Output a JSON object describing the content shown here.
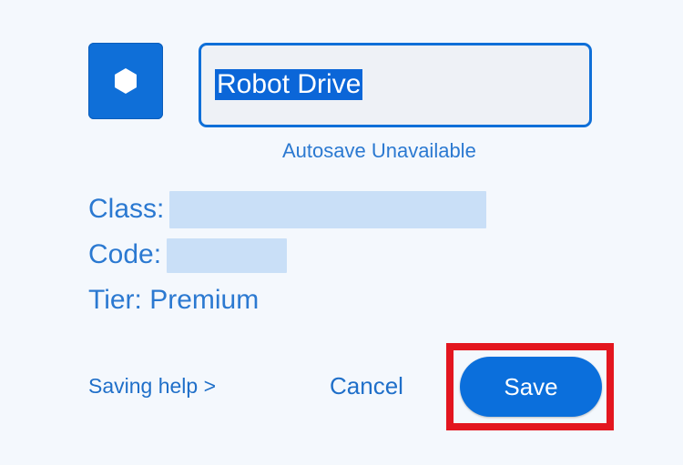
{
  "app_icon": {
    "icon": "hexagon-icon",
    "color": "#0f6fd8"
  },
  "name_field": {
    "value": "Robot Drive",
    "selected": true
  },
  "autosave_note": "Autosave Unavailable",
  "details": {
    "class_label": "Class:",
    "code_label": "Code:",
    "tier_label": "Tier: Premium"
  },
  "footer": {
    "help_link": "Saving help >",
    "cancel_label": "Cancel",
    "save_label": "Save"
  },
  "colors": {
    "accent": "#0f6fd8",
    "text_blue": "#2b79d1",
    "highlight": "#e3161f",
    "background": "#f4f8fd"
  }
}
